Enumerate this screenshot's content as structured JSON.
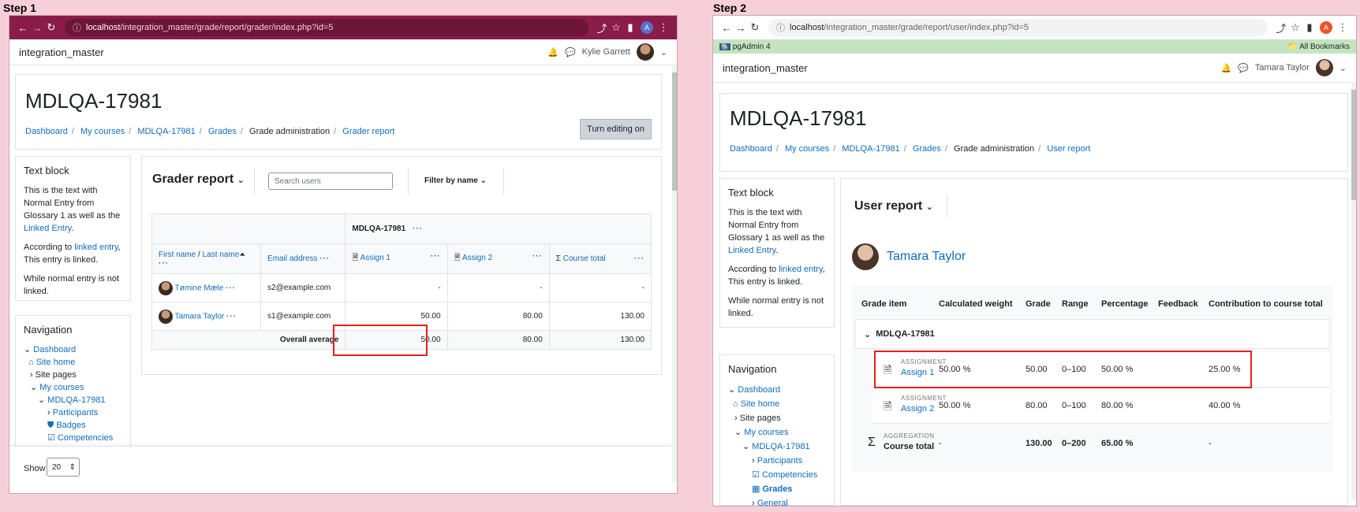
{
  "step1": {
    "label": "Step 1",
    "url_host": "localhost",
    "url_path": "/integration_master/grade/report/grader/index.php?id=5",
    "site_name": "integration_master",
    "user_name": "Kylie Garrett",
    "course_title": "MDLQA-17981",
    "breadcrumbs": [
      "Dashboard",
      "My courses",
      "MDLQA-17981",
      "Grades",
      "Grade administration",
      "Grader report"
    ],
    "turn_editing_label": "Turn editing on",
    "text_block": {
      "title": "Text block",
      "p1a": "This is the text with Normal Entry from Glossary 1 as well as the ",
      "p1link": "Linked Entry",
      "p1end": ".",
      "p2a": "According to ",
      "p2link": "linked entry",
      "p2b": ", This entry is linked.",
      "p3": "While normal entry is not linked."
    },
    "navigation": {
      "title": "Navigation",
      "items": [
        "Dashboard",
        "Site home",
        "Site pages",
        "My courses",
        "MDLQA-17981",
        "Participants",
        "Badges",
        "Competencies"
      ]
    },
    "report_title": "Grader report",
    "search_placeholder": "Search users",
    "filter_label": "Filter by name",
    "table": {
      "course_header": "MDLQA-17981",
      "col_first": "First name",
      "col_slash": " / ",
      "col_last": "Last name",
      "col_email": "Email address",
      "col_assign1": "Assign 1",
      "col_assign2": "Assign 2",
      "col_total": "Course total",
      "rows": [
        {
          "name": "Tømine Mæle",
          "email": "s2@example.com",
          "a1": "-",
          "a2": "-",
          "total": "-"
        },
        {
          "name": "Tamara Taylor",
          "email": "s1@example.com",
          "a1": "50.00",
          "a2": "80.00",
          "total": "130.00"
        }
      ],
      "avg_label": "Overall average",
      "avg_a1": "50.00",
      "avg_a2": "80.00",
      "avg_total": "130.00"
    },
    "show_label": "Show",
    "show_value": "20"
  },
  "step2": {
    "label": "Step 2",
    "url_host": "localhost",
    "url_path": "/integration_master/grade/report/user/index.php?id=5",
    "bookmark_pgadmin": "pgAdmin 4",
    "bookmark_all": "All Bookmarks",
    "site_name": "integration_master",
    "user_name": "Tamara Taylor",
    "course_title": "MDLQA-17981",
    "breadcrumbs": [
      "Dashboard",
      "My courses",
      "MDLQA-17981",
      "Grades",
      "Grade administration",
      "User report"
    ],
    "text_block": {
      "title": "Text block",
      "p1a": "This is the text with Normal Entry from Glossary 1 as well as the ",
      "p1link": "Linked Entry",
      "p1end": ".",
      "p2a": "According to ",
      "p2link": "linked entry",
      "p2b": ", This entry is linked.",
      "p3": "While normal entry is not linked."
    },
    "navigation": {
      "title": "Navigation",
      "items": [
        "Dashboard",
        "Site home",
        "Site pages",
        "My courses",
        "MDLQA-17981",
        "Participants",
        "Competencies",
        "Grades",
        "General"
      ]
    },
    "report_title": "User report",
    "student_name": "Tamara Taylor",
    "headers": [
      "Grade item",
      "Calculated weight",
      "Grade",
      "Range",
      "Percentage",
      "Feedback",
      "Contribution to course total"
    ],
    "category": "MDLQA-17981",
    "items": [
      {
        "type": "ASSIGNMENT",
        "name": "Assign 1",
        "weight": "50.00 %",
        "grade": "50.00",
        "range": "0–100",
        "pct": "50.00 %",
        "feedback": "",
        "contrib": "25.00 %"
      },
      {
        "type": "ASSIGNMENT",
        "name": "Assign 2",
        "weight": "50.00 %",
        "grade": "80.00",
        "range": "0–100",
        "pct": "80.00 %",
        "feedback": "",
        "contrib": "40.00 %"
      }
    ],
    "total": {
      "type": "AGGREGATION",
      "name": "Course total",
      "weight": "-",
      "grade": "130.00",
      "range": "0–200",
      "pct": "65.00 %",
      "feedback": "",
      "contrib": "-"
    }
  }
}
